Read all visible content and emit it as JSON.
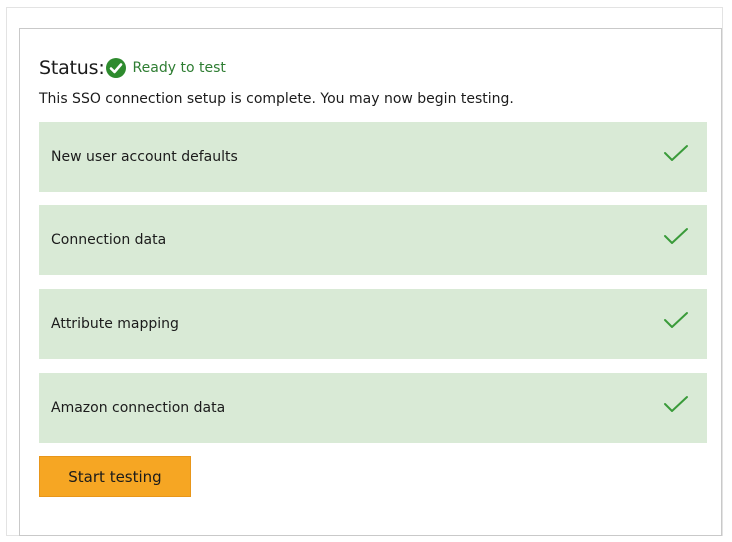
{
  "status": {
    "label": "Status:",
    "icon": "check-circle-icon",
    "value": "Ready to test",
    "description": "This SSO connection setup is complete. You may now begin testing."
  },
  "steps": [
    {
      "label": "New user account defaults",
      "icon": "checkmark-icon",
      "complete": true
    },
    {
      "label": "Connection data",
      "icon": "checkmark-icon",
      "complete": true
    },
    {
      "label": "Attribute mapping",
      "icon": "checkmark-icon",
      "complete": true
    },
    {
      "label": "Amazon connection data",
      "icon": "checkmark-icon",
      "complete": true
    }
  ],
  "actions": {
    "start_testing_label": "Start testing"
  },
  "colors": {
    "success_green": "#2e7d32",
    "step_background": "#d9ead6",
    "check_green": "#3a9b3a",
    "button_orange": "#f6a623"
  }
}
